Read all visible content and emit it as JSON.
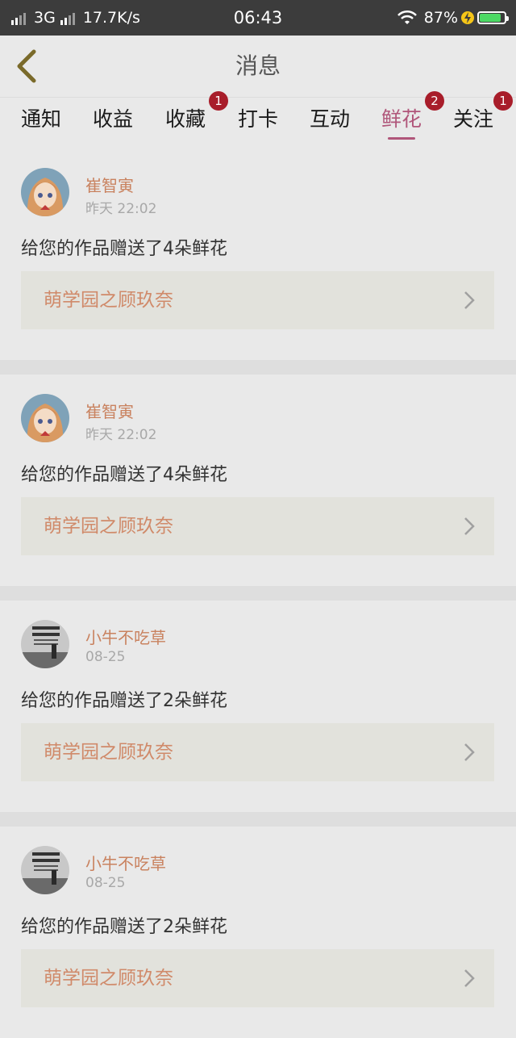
{
  "status_bar": {
    "network": "3G",
    "speed": "17.7K/s",
    "time": "06:43",
    "battery_percent": "87%",
    "battery_level": 0.87,
    "icons": [
      "signal-icon",
      "wifi-icon",
      "charging-icon",
      "battery-icon"
    ]
  },
  "nav": {
    "title": "消息",
    "back_icon": "chevron-left-icon"
  },
  "tabs": [
    {
      "label": "通知",
      "badge": ""
    },
    {
      "label": "收益",
      "badge": ""
    },
    {
      "label": "收藏",
      "badge": "1"
    },
    {
      "label": "打卡",
      "badge": ""
    },
    {
      "label": "互动",
      "badge": ""
    },
    {
      "label": "鲜花",
      "badge": "2",
      "active": true
    },
    {
      "label": "关注",
      "badge": "1"
    }
  ],
  "colors": {
    "accent": "#b0567a",
    "badge": "#a81d2a",
    "name": "#c9825f",
    "link": "#d08a6a"
  },
  "messages": [
    {
      "name": "崔智寅",
      "time": "昨天 22:02",
      "text": "给您的作品赠送了4朵鲜花",
      "work": "萌学园之顾玖奈",
      "avatar": "anime-girl-avatar"
    },
    {
      "name": "崔智寅",
      "time": "昨天 22:02",
      "text": "给您的作品赠送了4朵鲜花",
      "work": "萌学园之顾玖奈",
      "avatar": "anime-girl-avatar"
    },
    {
      "name": "小牛不吃草",
      "time": "08-25",
      "text": "给您的作品赠送了2朵鲜花",
      "work": "萌学园之顾玖奈",
      "avatar": "photo-avatar"
    },
    {
      "name": "小牛不吃草",
      "time": "08-25",
      "text": "给您的作品赠送了2朵鲜花",
      "work": "萌学园之顾玖奈",
      "avatar": "photo-avatar"
    }
  ]
}
